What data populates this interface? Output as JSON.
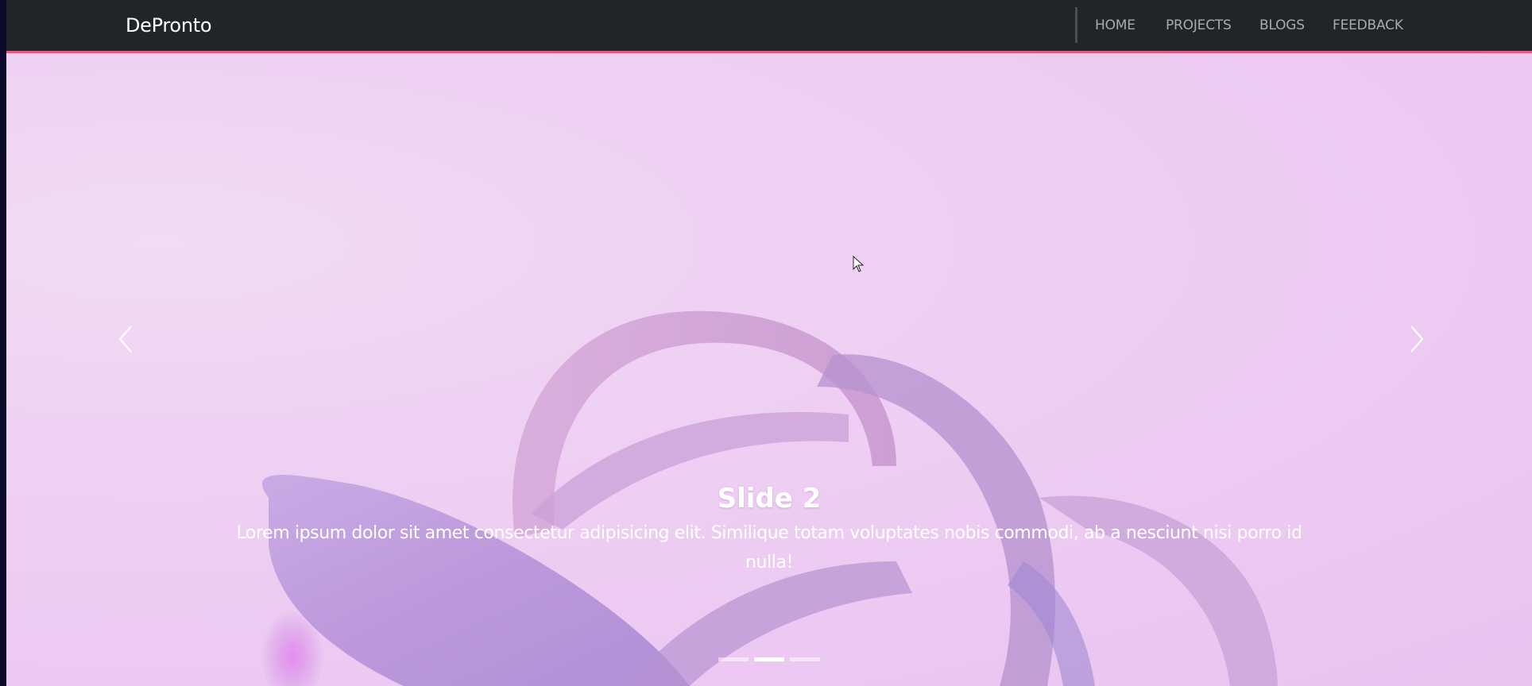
{
  "navbar": {
    "brand": "DePronto",
    "links": [
      {
        "label": "HOME"
      },
      {
        "label": "PROJECTS"
      },
      {
        "label": "BLOGS"
      },
      {
        "label": "FEEDBACK"
      }
    ],
    "accent_color": "#e25a84",
    "background": "#212529"
  },
  "carousel": {
    "slide_title": "Slide 2",
    "slide_text": "Lorem ipsum dolor sit amet consectetur adipisicing elit. Similique totam voluptates nobis commodi, ab a nesciunt nisi porro id nulla!",
    "prev_icon": "chevron-left-icon",
    "next_icon": "chevron-right-icon",
    "indicators": [
      {
        "state": "inactive"
      },
      {
        "state": "active"
      },
      {
        "state": "inactive"
      }
    ],
    "active_index": 2,
    "slide_count": 3
  }
}
